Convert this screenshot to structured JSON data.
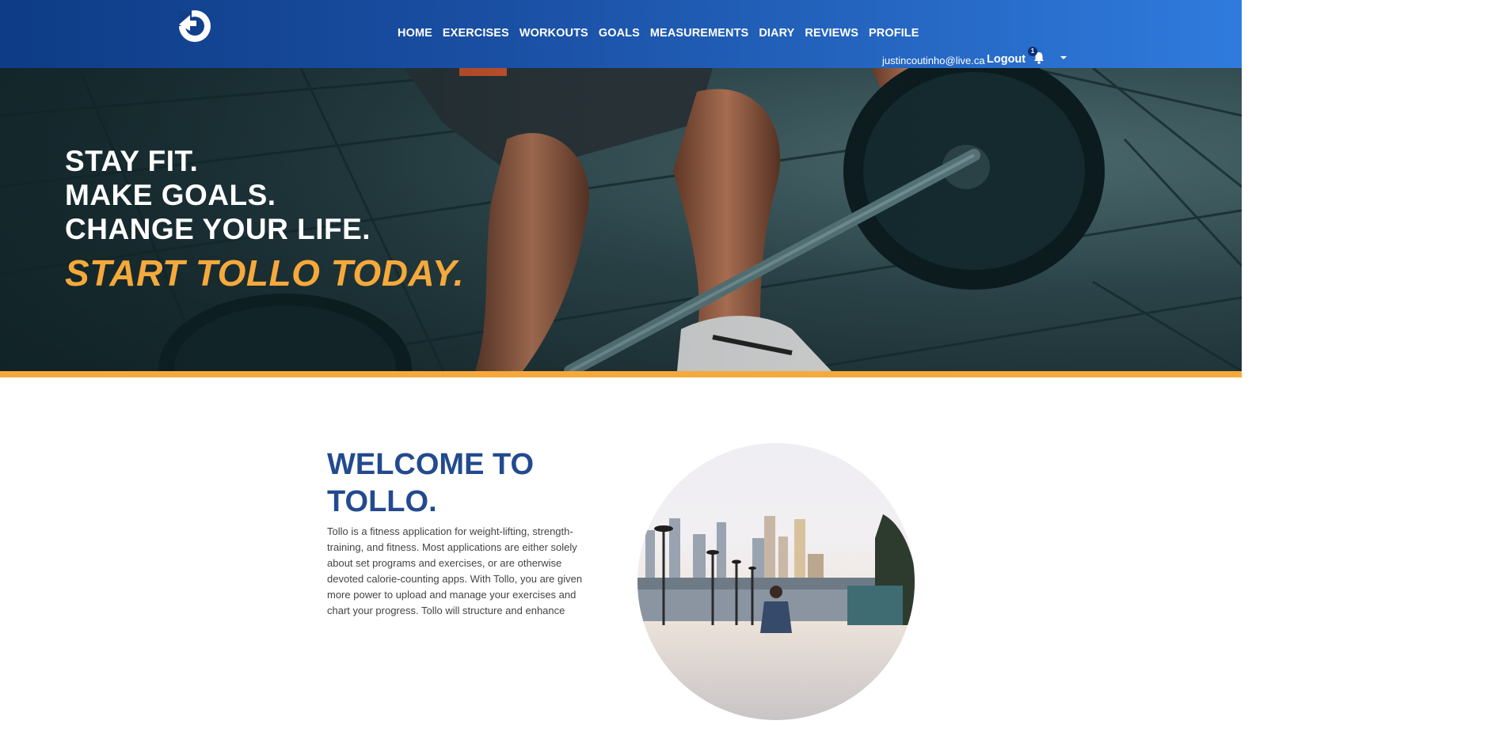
{
  "nav": {
    "logo_icon": "tollo-logo-icon",
    "links": [
      "HOME",
      "EXERCISES",
      "WORKOUTS",
      "GOALS",
      "MEASUREMENTS",
      "DIARY",
      "REVIEWS",
      "PROFILE"
    ],
    "user_email": "justincoutinho@live.ca",
    "logout_label": "Logout",
    "notification_count": "1",
    "bell_icon": "bell-icon",
    "dropdown_icon": "caret-down-icon"
  },
  "hero": {
    "lines": [
      "STAY FIT.",
      "MAKE GOALS.",
      "CHANGE YOUR LIFE."
    ],
    "cta": "START TOLLO TODAY.",
    "cta_color": "#f6a93b"
  },
  "welcome": {
    "title": "WELCOME TO TOLLO.",
    "body": "Tollo is a fitness application for weight-lifting, strength-training, and fitness. Most applications are either solely about set programs and exercises, or are otherwise devoted calorie-counting apps. With Tollo, you are given more power to upload and manage your exercises and chart your progress. Tollo will structure and enhance"
  },
  "colors": {
    "nav_start": "#0e3c86",
    "nav_end": "#2f7bdd",
    "accent": "#f6a93b",
    "title_blue": "#234a8f"
  }
}
